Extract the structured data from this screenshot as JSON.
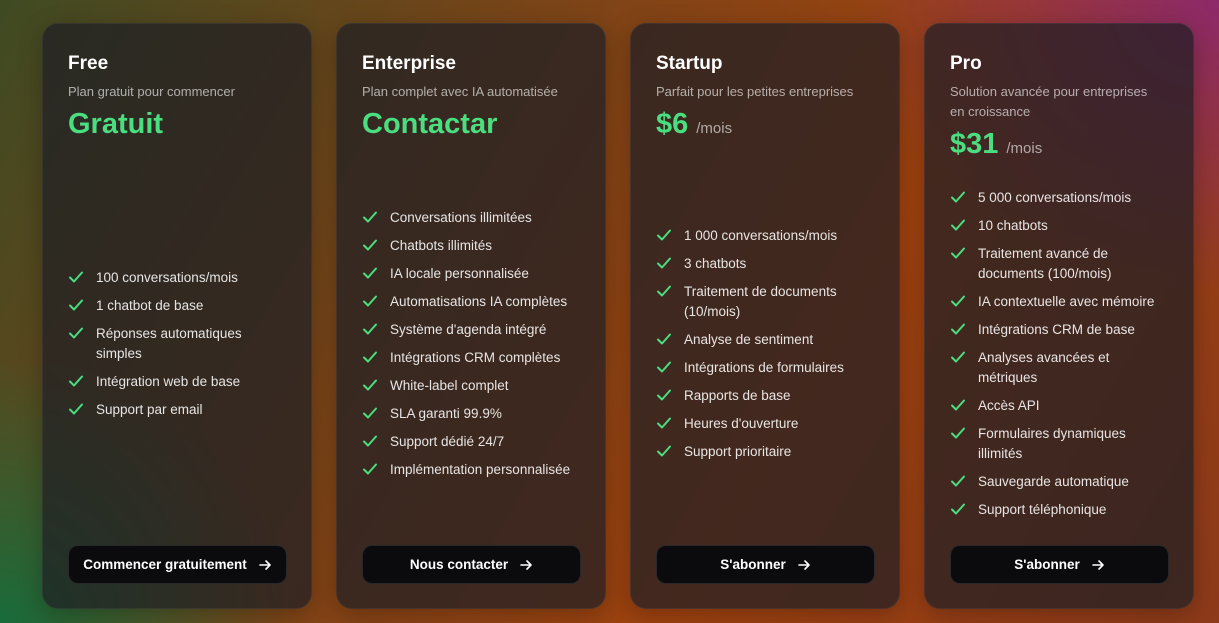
{
  "colors": {
    "accent": "#4ade80",
    "button_bg": "#0b0b0e"
  },
  "plans": [
    {
      "name": "Free",
      "description": "Plan gratuit pour commencer",
      "price": "Gratuit",
      "period": "",
      "features": [
        "100 conversations/mois",
        "1 chatbot de base",
        "Réponses automatiques simples",
        "Intégration web de base",
        "Support par email"
      ],
      "cta": "Commencer gratuitement"
    },
    {
      "name": "Enterprise",
      "description": "Plan complet avec IA automatisée",
      "price": "Contactar",
      "period": "",
      "features": [
        "Conversations illimitées",
        "Chatbots illimités",
        "IA locale personnalisée",
        "Automatisations IA complètes",
        "Système d'agenda intégré",
        "Intégrations CRM complètes",
        "White-label complet",
        "SLA garanti 99.9%",
        "Support dédié 24/7",
        "Implémentation personnalisée"
      ],
      "cta": "Nous contacter"
    },
    {
      "name": "Startup",
      "description": "Parfait pour les petites entreprises",
      "price": "$6",
      "period": "/mois",
      "features": [
        "1 000 conversations/mois",
        "3 chatbots",
        "Traitement de documents (10/mois)",
        "Analyse de sentiment",
        "Intégrations de formulaires",
        "Rapports de base",
        "Heures d'ouverture",
        "Support prioritaire"
      ],
      "cta": "S'abonner"
    },
    {
      "name": "Pro",
      "description": "Solution avancée pour entreprises en croissance",
      "price": "$31",
      "period": "/mois",
      "features": [
        "5 000 conversations/mois",
        "10 chatbots",
        "Traitement avancé de documents (100/mois)",
        "IA contextuelle avec mémoire",
        "Intégrations CRM de base",
        "Analyses avancées et métriques",
        "Accès API",
        "Formulaires dynamiques illimités",
        "Sauvegarde automatique",
        "Support téléphonique"
      ],
      "cta": "S'abonner"
    }
  ]
}
